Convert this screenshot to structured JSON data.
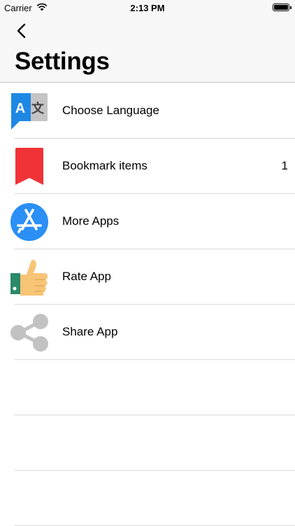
{
  "status": {
    "carrier": "Carrier",
    "time": "2:13 PM"
  },
  "nav": {
    "title": "Settings",
    "back_icon": "chevron-left-icon"
  },
  "items": [
    {
      "label": "Choose Language",
      "icon": "translate-icon",
      "count": ""
    },
    {
      "label": "Bookmark items",
      "icon": "bookmark-icon",
      "count": "1"
    },
    {
      "label": "More Apps",
      "icon": "app-store-icon",
      "count": ""
    },
    {
      "label": "Rate App",
      "icon": "thumbs-up-icon",
      "count": ""
    },
    {
      "label": "Share App",
      "icon": "share-icon",
      "count": ""
    }
  ],
  "colors": {
    "translate_blue": "#1e88e5",
    "bookmark_red": "#f03337",
    "app_store_blue": "#2b8ff5",
    "share_gray": "#c2c2c2"
  }
}
